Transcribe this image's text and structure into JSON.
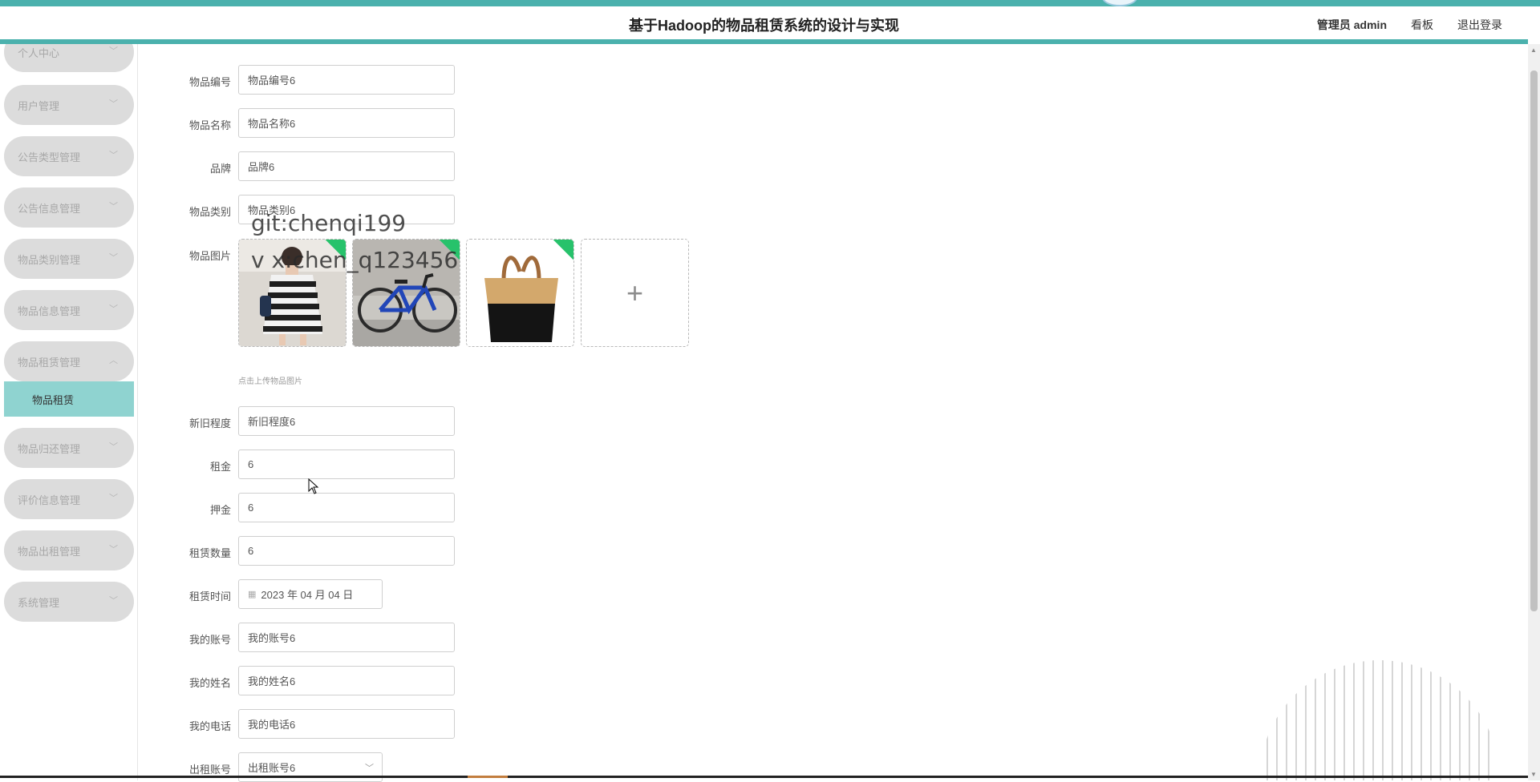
{
  "header": {
    "title": "基于Hadoop的物品租赁系统的设计与实现",
    "user": "管理员 admin",
    "board": "看板",
    "logout": "退出登录"
  },
  "sidebar": {
    "items": [
      {
        "label": "个人中心"
      },
      {
        "label": "用户管理"
      },
      {
        "label": "公告类型管理"
      },
      {
        "label": "公告信息管理"
      },
      {
        "label": "物品类别管理"
      },
      {
        "label": "物品信息管理"
      },
      {
        "label": "物品租赁管理",
        "expanded": true
      },
      {
        "label": "物品归还管理"
      },
      {
        "label": "评价信息管理"
      },
      {
        "label": "物品出租管理"
      },
      {
        "label": "系统管理"
      }
    ],
    "active_sub": "物品租赁"
  },
  "form": {
    "fields": [
      {
        "label": "物品编号",
        "value": "物品编号6"
      },
      {
        "label": "物品名称",
        "value": "物品名称6"
      },
      {
        "label": "品牌",
        "value": "品牌6"
      },
      {
        "label": "物品类别",
        "value": "物品类别6"
      },
      {
        "label": "物品图片"
      },
      {
        "label": "新旧程度",
        "value": "新旧程度6"
      },
      {
        "label": "租金",
        "value": "6"
      },
      {
        "label": "押金",
        "value": "6"
      },
      {
        "label": "租赁数量",
        "value": "6"
      },
      {
        "label": "租赁时间",
        "value": "2023 年 04 月 04 日"
      },
      {
        "label": "我的账号",
        "value": "我的账号6"
      },
      {
        "label": "我的姓名",
        "value": "我的姓名6"
      },
      {
        "label": "我的电话",
        "value": "我的电话6"
      },
      {
        "label": "出租账号",
        "value": "出租账号6"
      }
    ],
    "upload_hint": "点击上传物品图片",
    "upload_plus": "+"
  },
  "watermark": {
    "line1": "git:chenqi199",
    "line2": "v x:chen_q123456"
  },
  "colors": {
    "accent": "#4bb1ad",
    "active_sub_bg": "#8fd3d0",
    "menu_bg": "#dcdcdc"
  }
}
